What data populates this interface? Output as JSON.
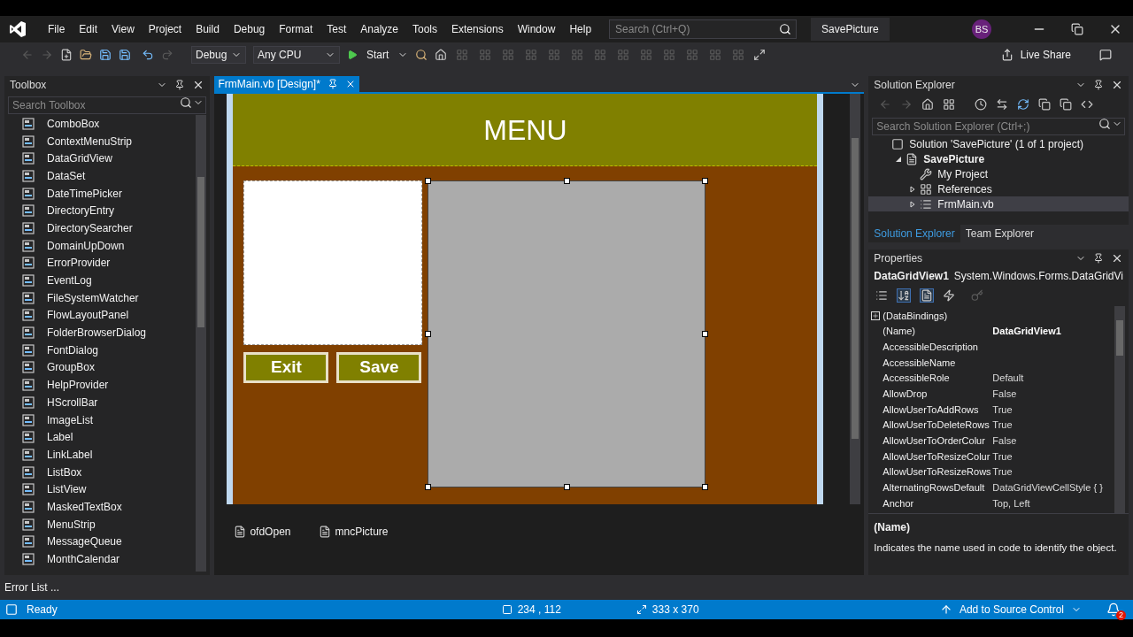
{
  "menu": [
    "File",
    "Edit",
    "View",
    "Project",
    "Build",
    "Debug",
    "Format",
    "Test",
    "Analyze",
    "Tools",
    "Extensions",
    "Window",
    "Help"
  ],
  "search": {
    "placeholder": "Search (Ctrl+Q)"
  },
  "solution_name": "SavePicture",
  "account": {
    "initials": "BS"
  },
  "toolbar": {
    "configuration": "Debug",
    "platform": "Any CPU",
    "start": "Start",
    "live_share": "Live Share"
  },
  "toolbox": {
    "title": "Toolbox",
    "search": {
      "placeholder": "Search Toolbox"
    },
    "items": [
      "ComboBox",
      "ContextMenuStrip",
      "DataGridView",
      "DataSet",
      "DateTimePicker",
      "DirectoryEntry",
      "DirectorySearcher",
      "DomainUpDown",
      "ErrorProvider",
      "EventLog",
      "FileSystemWatcher",
      "FlowLayoutPanel",
      "FolderBrowserDialog",
      "FontDialog",
      "GroupBox",
      "HelpProvider",
      "HScrollBar",
      "ImageList",
      "Label",
      "LinkLabel",
      "ListBox",
      "ListView",
      "MaskedTextBox",
      "MenuStrip",
      "MessageQueue",
      "MonthCalendar"
    ]
  },
  "editor": {
    "tabs": [
      {
        "label": "FrmMain.vb [Design]*",
        "selected": true
      }
    ],
    "form": {
      "title": "MENU",
      "buttons": [
        "Exit",
        "Save"
      ]
    },
    "tray": [
      "ofdOpen",
      "mncPicture"
    ]
  },
  "solution_explorer": {
    "title": "Solution Explorer",
    "search": {
      "placeholder": "Search Solution Explorer (Ctrl+;)"
    },
    "tree": [
      {
        "label": "Solution 'SavePicture' (1 of 1 project)",
        "kind": "solution",
        "selected": false,
        "children": [
          {
            "label": "SavePicture",
            "kind": "project",
            "expanded": true,
            "selected": false,
            "children": [
              {
                "label": "My Project",
                "kind": "settings",
                "selected": false
              },
              {
                "label": "References",
                "kind": "references",
                "expanded": false,
                "selected": false
              },
              {
                "label": "FrmMain.vb",
                "kind": "form",
                "expanded": false,
                "selected": true
              }
            ]
          }
        ]
      }
    ],
    "tabs": [
      {
        "label": "Solution Explorer",
        "selected": true
      },
      {
        "label": "Team Explorer",
        "selected": false
      }
    ]
  },
  "properties": {
    "title": "Properties",
    "object": "DataGridView1",
    "type": "System.Windows.Forms.DataGridVi",
    "rows": [
      {
        "name": "(DataBindings)",
        "kind": "group",
        "expanded": false
      },
      {
        "name": "(Name)",
        "kind": "property",
        "value": "DataGridView1",
        "bold": true
      },
      {
        "name": "AccessibleDescription",
        "kind": "property"
      },
      {
        "name": "AccessibleName",
        "kind": "property"
      },
      {
        "name": "AccessibleRole",
        "kind": "property",
        "value": "Default",
        "bold": false
      },
      {
        "name": "AllowDrop",
        "kind": "property",
        "value": "False",
        "bold": false
      },
      {
        "name": "AllowUserToAddRows",
        "kind": "property",
        "value": "True",
        "bold": false
      },
      {
        "name": "AllowUserToDeleteRows",
        "kind": "property",
        "value": "True",
        "bold": false
      },
      {
        "name": "AllowUserToOrderColur",
        "kind": "property",
        "value": "False",
        "bold": false
      },
      {
        "name": "AllowUserToResizeColur",
        "kind": "property",
        "value": "True",
        "bold": false
      },
      {
        "name": "AllowUserToResizeRows",
        "kind": "property",
        "value": "True",
        "bold": false
      },
      {
        "name": "AlternatingRowsDefault",
        "kind": "property",
        "value": "DataGridViewCellStyle { }",
        "bold": false
      },
      {
        "name": "Anchor",
        "kind": "property",
        "value": "Top, Left",
        "bold": false
      }
    ],
    "description": {
      "title": "(Name)",
      "text": "Indicates the name used in code to identify the object."
    }
  },
  "error_list": "Error List ...",
  "status_bar": {
    "state": "Ready",
    "position": "234 , 112",
    "size": "333 x 370",
    "source_control": "Add to Source Control",
    "notifications": "2"
  }
}
